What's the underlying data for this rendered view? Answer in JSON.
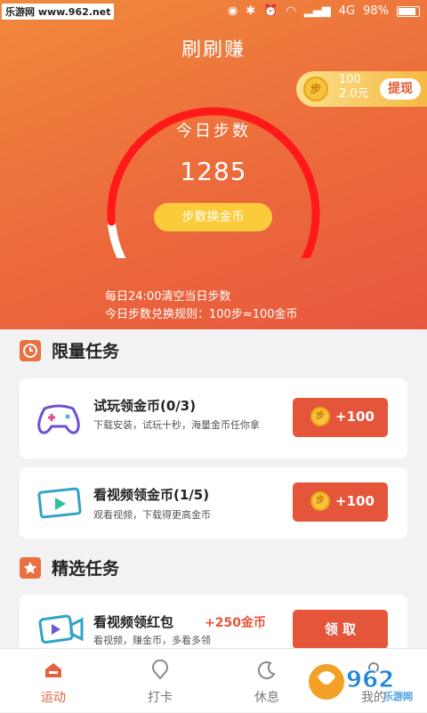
{
  "status_bar": {
    "site": "乐游网 www.962.net",
    "network": "4G",
    "battery": "98%"
  },
  "header": {
    "title": "刷刷赚"
  },
  "withdraw": {
    "coin_glyph": "步",
    "coins": "100",
    "money": "2.0元",
    "button": "提现"
  },
  "pedometer": {
    "label": "今日步数",
    "steps": "1285",
    "exchange_button": "步数换金币",
    "progress": 0.85,
    "rule_reset": "每日24:00清空当日步数",
    "rule_exchange": "今日步数兑换规则：100步≈100金币"
  },
  "limited_tasks": {
    "title": "限量任务",
    "items": [
      {
        "title": "试玩领金币(0/3)",
        "desc": "下载安装，试玩十秒，海量金币任你拿",
        "reward": "+100",
        "coin_glyph": "步"
      },
      {
        "title": "看视频领金币(1/5)",
        "desc": "观看视频，下载得更高金币",
        "reward": "+100",
        "coin_glyph": "步"
      }
    ]
  },
  "selected_tasks": {
    "title": "精选任务",
    "items": [
      {
        "title": "看视频领红包",
        "bonus": "+250金币",
        "desc": "看视频，赚金币，多看多领",
        "button": "领 取"
      }
    ]
  },
  "tabs": [
    {
      "label": "运动",
      "active": true
    },
    {
      "label": "打卡"
    },
    {
      "label": "休息"
    },
    {
      "label": "我的"
    }
  ],
  "watermark": {
    "text": "962",
    "sub": "乐游网"
  },
  "colors": {
    "accent": "#e8613e",
    "button": "#e5553a",
    "gauge": "#ff1a1a"
  }
}
